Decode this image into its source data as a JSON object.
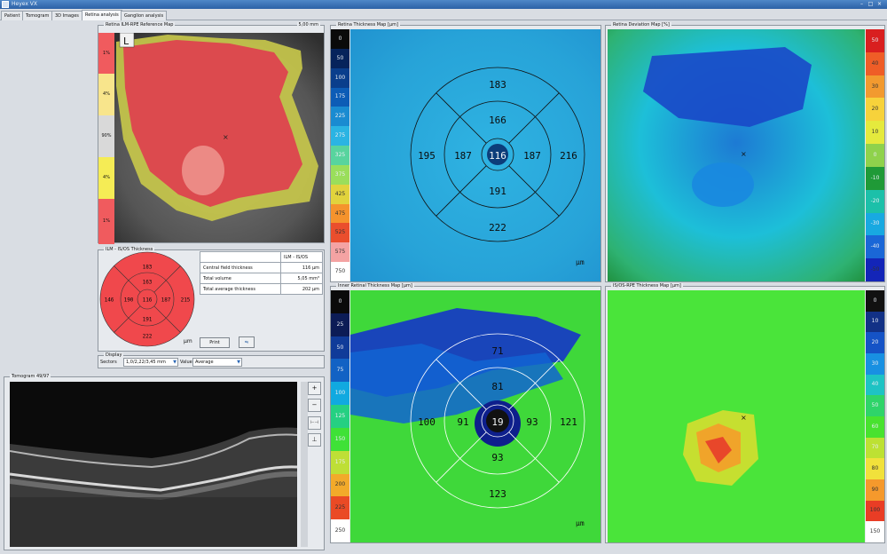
{
  "window": {
    "title": "Heyex VX",
    "controls": [
      "–",
      "□",
      "×"
    ]
  },
  "tabs": [
    "Patient",
    "Tomogram",
    "3D Images",
    "Retina analysis",
    "Ganglion analysis"
  ],
  "active_tab": "Retina analysis",
  "reference_map": {
    "label": "Retina ILM-RPE Reference Map",
    "scale_text": "5,00 mm",
    "eye": "L",
    "legend_values": [
      "1%",
      "4%",
      "90%",
      "4%",
      "1%"
    ],
    "legend_colors": [
      "#f05b5e",
      "#f8e58c",
      "#d9d9d9",
      "#f5ec55",
      "#f05b5e"
    ]
  },
  "grid_chart": {
    "label": "ILM - IS/OS Thickness",
    "values": {
      "top_outer": "183",
      "top_inner": "163",
      "left_outer": "146",
      "left_inner": "190",
      "center": "116",
      "right_inner": "187",
      "right_outer": "215",
      "bottom_inner": "191",
      "bottom_outer": "222"
    },
    "unit": "µm"
  },
  "stats_table": {
    "header": "ILM - IS/OS",
    "rows": [
      {
        "label": "Central field thickness",
        "value": "116 µm"
      },
      {
        "label": "Total volume",
        "value": "5,05 mm³"
      },
      {
        "label": "Total average thickness",
        "value": "202 µm"
      }
    ]
  },
  "buttons": {
    "print": "Print",
    "export": "⇋"
  },
  "display": {
    "label": "Display",
    "sectors_label": "Sectors",
    "sectors_value": "1,0/2,22/3,45 mm",
    "value_label": "Value",
    "value_value": "Average"
  },
  "tomogram": {
    "label": "Tomogram 49/97"
  },
  "tomogram_tools": [
    "+",
    "−",
    "⊢⊣",
    "⊥"
  ],
  "maps": [
    {
      "label": "Retina Thickness Map [µm]",
      "unit": "µm",
      "scale": [
        "0",
        "50",
        "100",
        "175",
        "225",
        "275",
        "325",
        "375",
        "425",
        "475",
        "525",
        "575",
        "750"
      ],
      "scale_colors": [
        "#0a0a0a",
        "#06235b",
        "#0a3e8c",
        "#0d5cb6",
        "#1a8bd1",
        "#2bb4e3",
        "#58d49e",
        "#9ade5b",
        "#e1d33d",
        "#f5932d",
        "#ea4e2d",
        "#f4a3a3",
        "#ffffff"
      ],
      "grid": {
        "top_outer": "183",
        "top_inner": "166",
        "left_outer": "195",
        "left_inner": "187",
        "center": "116",
        "right_inner": "187",
        "right_outer": "216",
        "bottom_inner": "191",
        "bottom_outer": "222"
      },
      "color": "#27a7dc"
    },
    {
      "label": "Retina Deviation Map [%]",
      "scale": [
        "50",
        "40",
        "30",
        "20",
        "10",
        "0",
        "-10",
        "-20",
        "-30",
        "-40",
        "-50"
      ],
      "scale_colors": [
        "#d91f1f",
        "#ef5d27",
        "#f29a2f",
        "#f7d23b",
        "#e5ea3d",
        "#8fd24c",
        "#1f9a37",
        "#1cc0a9",
        "#18a9e1",
        "#1a67d7",
        "#1325b8"
      ]
    },
    {
      "label": "Inner Retinal Thickness Map [µm]",
      "unit": "µm",
      "scale": [
        "0",
        "25",
        "50",
        "75",
        "100",
        "125",
        "150",
        "175",
        "200",
        "225",
        "250"
      ],
      "scale_colors": [
        "#0a0a0a",
        "#0c1c56",
        "#103b99",
        "#1262c4",
        "#11a9e0",
        "#25d082",
        "#3fe137",
        "#bedf36",
        "#f2aa2a",
        "#ea4a25",
        "#ffffff"
      ],
      "grid": {
        "top_outer": "71",
        "top_inner": "81",
        "left_outer": "100",
        "left_inner": "91",
        "center": "19",
        "right_inner": "93",
        "right_outer": "121",
        "bottom_inner": "93",
        "bottom_outer": "123"
      }
    },
    {
      "label": "IS/OS-RPE Thickness Map [µm]",
      "scale": [
        "0",
        "10",
        "20",
        "30",
        "40",
        "50",
        "60",
        "70",
        "80",
        "90",
        "100",
        "150"
      ],
      "scale_colors": [
        "#111111",
        "#123186",
        "#1553c6",
        "#1890e2",
        "#1ec3c4",
        "#2fd469",
        "#48e22f",
        "#bde133",
        "#f1e13b",
        "#f5992c",
        "#e93d25",
        "#ffffff"
      ]
    }
  ]
}
